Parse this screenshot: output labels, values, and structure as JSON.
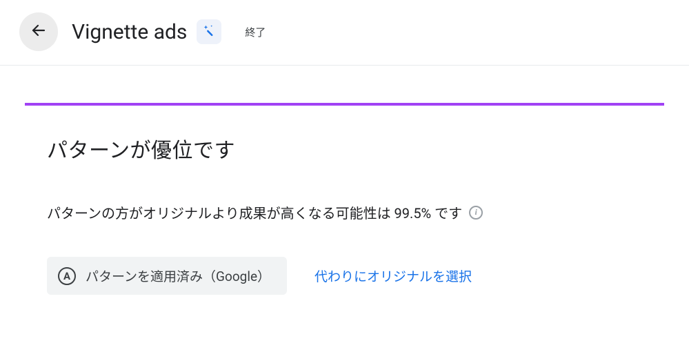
{
  "header": {
    "title": "Vignette ads",
    "status": "終了"
  },
  "card": {
    "heading": "パターンが優位です",
    "subtext": "パターンの方がオリジナルより成果が高くなる可能性は 99.5% です",
    "applied_badge_letter": "A",
    "applied_label": "パターンを適用済み（Google）",
    "alt_link": "代わりにオリジナルを選択"
  }
}
